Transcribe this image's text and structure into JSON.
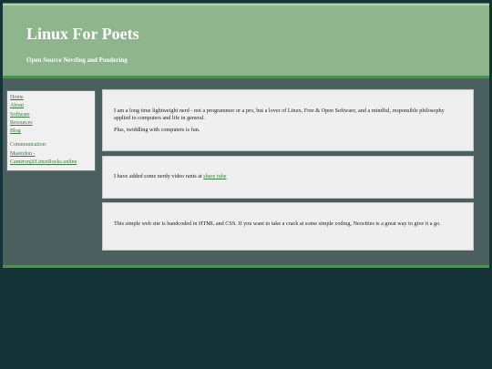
{
  "header": {
    "title": "Linux For Poets",
    "subtitle": "Open Source Nerding and Pondering"
  },
  "sidebar": {
    "links": [
      "Home",
      "About",
      "Software",
      "Resources",
      "Blog"
    ],
    "communication_label": "Communication:",
    "mastodon_label": "Mastodon -",
    "mastodon_handle": "Cameron@LinuxRocks.online"
  },
  "main": {
    "intro_paragraph_1": "I am a long time lightweight nerd - not a programmer or a pro, but a lover of Linux, Free & Open Software, and a mindful, responsible philosophy applied to computers and life in general.",
    "intro_paragraph_2": "Plus, twiddling with computers is fun.",
    "video_text": "I have added some nerdy video rants at ",
    "video_link": "share tube",
    "site_note": "This simple web site is handcoded in HTML and CSS. If you want to take a crack at some simple coding, Neocities is a great way to give it a go."
  },
  "colors": {
    "page_background": "#153237",
    "header_background": "#8fb58c",
    "accent_green": "#3aa13a",
    "link_color": "#3a7a3a"
  }
}
